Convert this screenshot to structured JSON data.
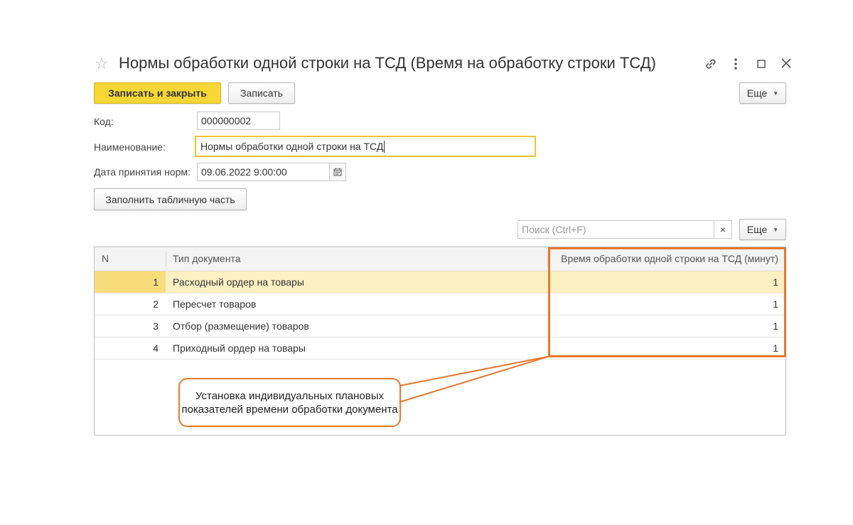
{
  "window": {
    "title": "Нормы обработки одной строки на ТСД (Время на обработку строки ТСД)",
    "icons": [
      "star-icon",
      "link-icon",
      "more-vertical-icon",
      "maximize-icon",
      "close-icon"
    ]
  },
  "toolbar": {
    "save_close_label": "Записать и закрыть",
    "save_label": "Записать",
    "more_label": "Еще"
  },
  "form": {
    "code_label": "Код:",
    "code_value": "000000002",
    "name_label": "Наименование:",
    "name_value": "Нормы обработки одной строки на ТСД",
    "date_label": "Дата принятия норм:",
    "date_value": "09.06.2022  9:00:00",
    "fill_button_label": "Заполнить табличную часть"
  },
  "search": {
    "placeholder": "Поиск (Ctrl+F)",
    "clear_label": "×",
    "more_label": "Еще"
  },
  "table": {
    "columns": [
      "N",
      "Тип документа",
      "Время обработки одной строки на ТСД (минут)"
    ],
    "rows": [
      {
        "n": "1",
        "type": "Расходный ордер на товары",
        "time": "1"
      },
      {
        "n": "2",
        "type": "Пересчет товаров",
        "time": "1"
      },
      {
        "n": "3",
        "type": "Отбор (размещение) товаров",
        "time": "1"
      },
      {
        "n": "4",
        "type": "Приходный ордер на товары",
        "time": "1"
      }
    ],
    "selected_row": 0
  },
  "annotation": {
    "text": "Установка индивидуальных плановых показателей времени обработки документа",
    "color": "#e8782c"
  },
  "colors": {
    "primary_button": "#f7d735",
    "focus_border": "#f1c232",
    "selected_row": "#fdf1c3"
  }
}
